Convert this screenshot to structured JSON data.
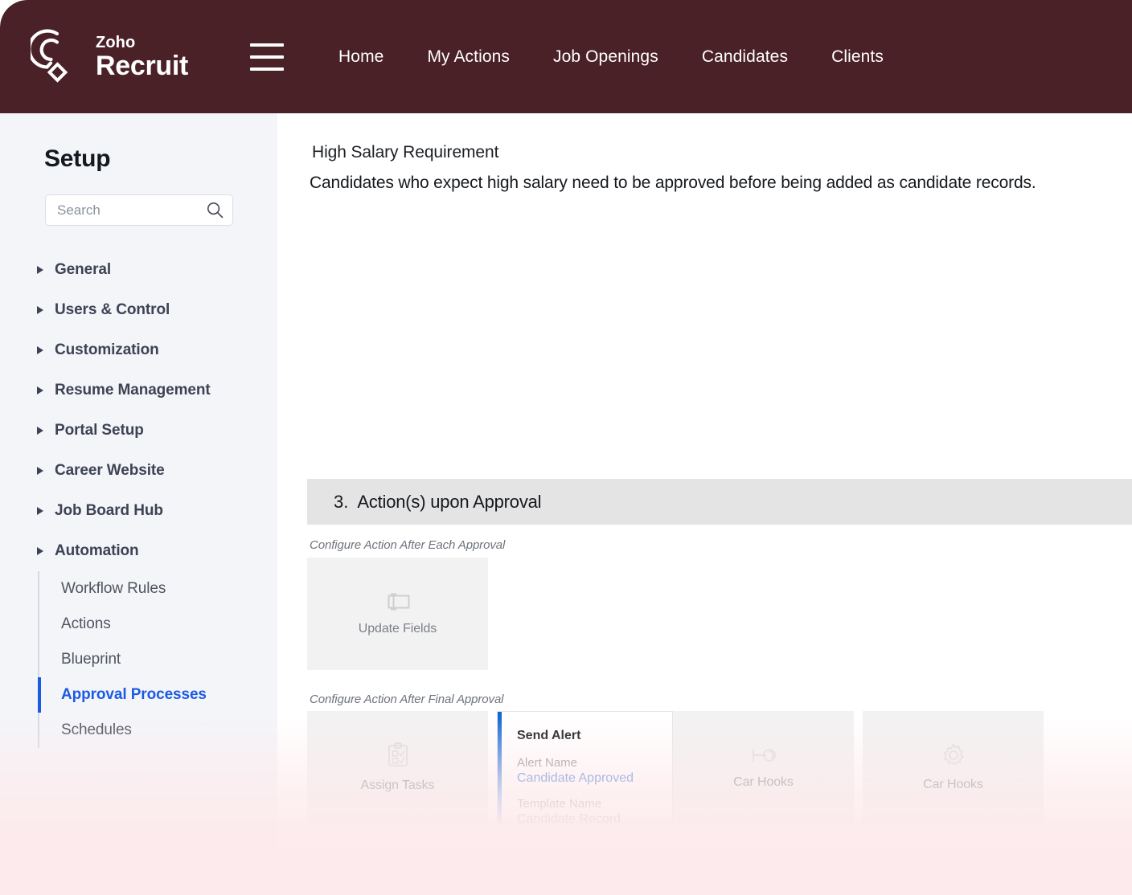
{
  "brand": {
    "zoho": "Zoho",
    "product": "Recruit",
    "logo_icon": "zoho-recruit-logo-icon",
    "menu_icon": "hamburger-menu-icon",
    "bar_color": "#4A2127"
  },
  "topnav": {
    "links": [
      {
        "label": "Home"
      },
      {
        "label": "My Actions"
      },
      {
        "label": "Job Openings"
      },
      {
        "label": "Candidates"
      },
      {
        "label": "Clients"
      }
    ]
  },
  "sidebar": {
    "title": "Setup",
    "search": {
      "placeholder": "Search",
      "value": "",
      "icon": "search-icon"
    },
    "groups": [
      {
        "label": "General"
      },
      {
        "label": "Users & Control"
      },
      {
        "label": "Customization"
      },
      {
        "label": "Resume Management"
      },
      {
        "label": "Portal Setup"
      },
      {
        "label": "Career Website"
      },
      {
        "label": "Job Board Hub"
      },
      {
        "label": "Automation"
      }
    ],
    "automation_children": [
      {
        "label": "Workflow Rules",
        "active": false
      },
      {
        "label": "Actions",
        "active": false
      },
      {
        "label": "Blueprint",
        "active": false
      },
      {
        "label": "Approval Processes",
        "active": true
      },
      {
        "label": "Schedules",
        "active": false
      }
    ],
    "active_color": "#1B5BE3",
    "background": "#F4F5F9"
  },
  "main": {
    "rule_title": "High Salary Requirement",
    "rule_description": "Candidates who expect high salary need to be approved before being added as candidate records.",
    "section": {
      "number": "3.",
      "title": "Action(s) upon Approval",
      "bar_color": "#E4E4E4"
    },
    "each_approval": {
      "caption": "Configure Action After Each Approval",
      "cards": [
        {
          "label": "Update Fields",
          "icon": "update-fields-icon"
        }
      ]
    },
    "final_approval": {
      "caption": "Configure Action After Final Approval",
      "cards": [
        {
          "label": "Assign Tasks",
          "icon": "assign-tasks-clipboard-icon"
        },
        {
          "label": "Car Hooks",
          "icon": "webhook-key-icon"
        },
        {
          "label": "Car Hooks",
          "icon": "gear-icon"
        }
      ],
      "alert_card": {
        "title": "Send Alert",
        "alert_name_label": "Alert Name",
        "alert_name_value": "Candidate Approved",
        "template_name_label": "Template Name",
        "template_name_value": "Candidate Record Approved",
        "accent_color": "#1367D4"
      }
    }
  },
  "overlay": {
    "fade_color": "#FDEAEC"
  }
}
